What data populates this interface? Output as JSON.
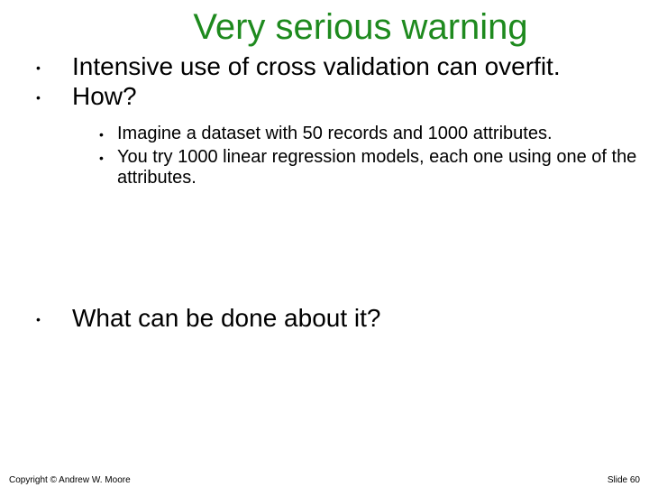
{
  "title": "Very serious warning",
  "bullets": {
    "b1": "Intensive use of cross validation can overfit.",
    "b2": "How?",
    "sub1": "Imagine a dataset with 50 records and 1000 attributes.",
    "sub2": "You try 1000 linear regression models, each one using one of the attributes.",
    "b3": "What can be done about it?"
  },
  "footer": {
    "copyright": "Copyright © Andrew W. Moore",
    "slide": "Slide 60"
  }
}
